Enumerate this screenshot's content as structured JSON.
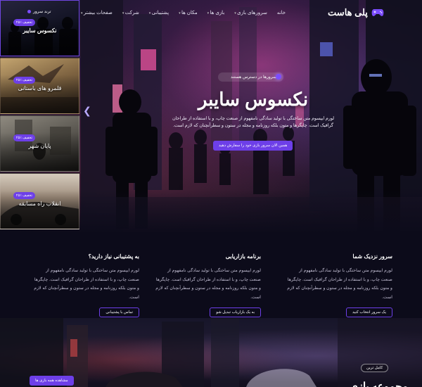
{
  "colors": {
    "accent": "#6d3fe8",
    "background": "#0c0b1a"
  },
  "nav": {
    "logo_text": "پلی هاست",
    "logo_icon": "gamepad-icon",
    "links": [
      "خانه",
      "سرورهای بازی",
      "بازی ها",
      "مکان ها",
      "پشتیبانی",
      "شرکت",
      "صفحات بیشتر"
    ]
  },
  "sidebar": {
    "top_tag": "ترند سرور",
    "cards": [
      {
        "badge": "۲۵٪ تخفیف",
        "title": "نکسوس سایبر"
      },
      {
        "badge": "۲۵٪ تخفیف",
        "title": "قلمرو های باستانی"
      },
      {
        "badge": "۲۵٪ تخفیف",
        "title": "پایان شهر"
      },
      {
        "badge": "۲۵٪ تخفیف",
        "title": "انقلاب راه مسابقه"
      }
    ]
  },
  "hero": {
    "pill": "سرورها در دسترس هستند",
    "title": "نکسوس سایبر",
    "description": "لورم ایپسوم متن ساختگی با تولید سادگی نامفهوم از صنعت چاپ، و با استفاده از طراحان گرافیک است. چاپگرها و متون بلکه روزنامه و مجله در ستون و سطرآنچنان که لازم است.",
    "button": "همین الان سرور بازی خود را سفارش دهید"
  },
  "features": [
    {
      "title": "سرور نزدیک شما",
      "description": "لورم ایپسوم متن ساختگی با تولید سادگی نامفهوم از صنعت چاپ، و با استفاده از طراحان گرافیک است. چاپگرها و متون بلکه روزنامه و مجله در ستون و سطرآنچنان که لازم است.",
      "button": "یک سرور انتخاب کنید"
    },
    {
      "title": "برنامه بازاریابی",
      "description": "لورم ایپسوم متن ساختگی با تولید سادگی نامفهوم از صنعت چاپ، و با استفاده از طراحان گرافیک است. چاپگرها و متون بلکه روزنامه و مجله در ستون و سطرآنچنان که لازم است.",
      "button": "به یک بازاریاب تبدیل شو"
    },
    {
      "title": "به پشتیبانی نیاز دارید؟",
      "description": "لورم ایپسوم متن ساختگی با تولید سادگی نامفهوم از صنعت چاپ، و با استفاده از طراحان گرافیک است. چاپگرها و متون بلکه روزنامه و مجله در ستون و سطرآنچنان که لازم است.",
      "button": "تماس با پشتیبانی"
    }
  ],
  "games": {
    "tag": "کامل ترین",
    "button": "مشاهده همه بازی ها",
    "heading": "مجموعه بازی"
  }
}
